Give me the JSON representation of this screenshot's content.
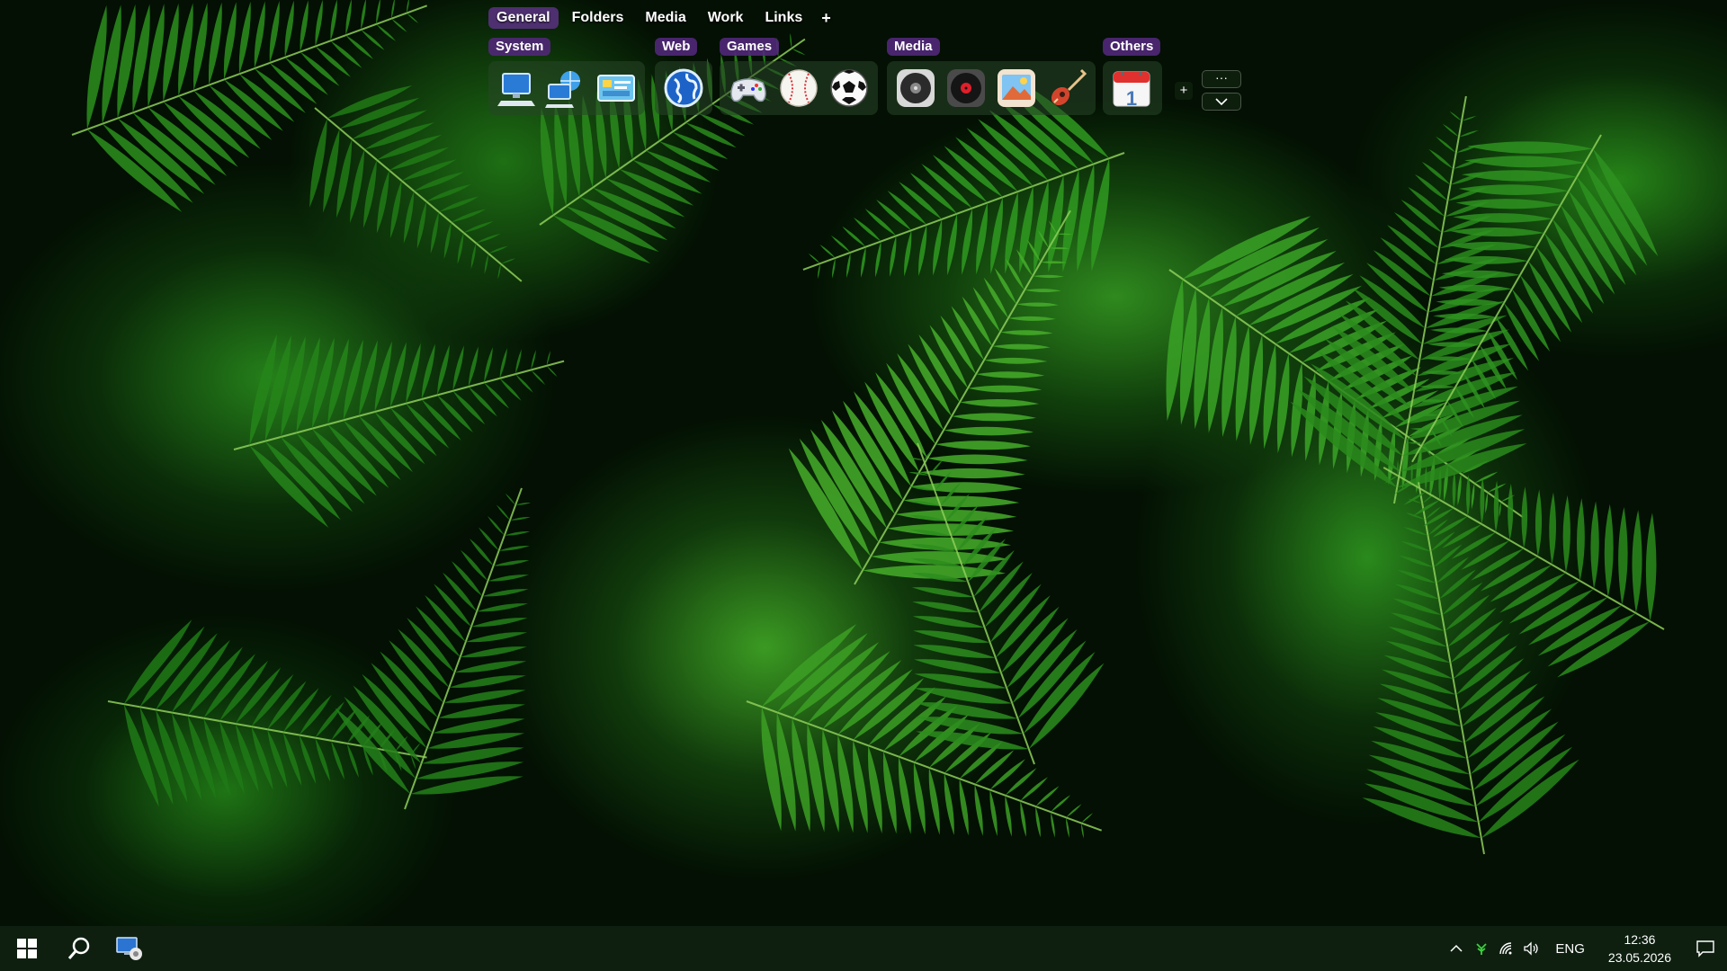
{
  "launcher": {
    "tabs": [
      {
        "label": "General",
        "active": true
      },
      {
        "label": "Folders",
        "active": false
      },
      {
        "label": "Media",
        "active": false
      },
      {
        "label": "Work",
        "active": false
      },
      {
        "label": "Links",
        "active": false
      }
    ],
    "add_tab_label": "+",
    "groups": [
      {
        "label": "System",
        "icons": [
          "desktop-computer-icon",
          "network-computer-icon",
          "control-panel-icon"
        ]
      },
      {
        "label": "Web",
        "icons": [
          "globe-browser-icon"
        ]
      },
      {
        "label": "Games",
        "icons": [
          "gamepad-icon",
          "baseball-icon",
          "soccer-ball-icon"
        ]
      },
      {
        "label": "Media",
        "icons": [
          "audio-disc-icon",
          "music-record-icon",
          "photos-icon",
          "guitar-icon"
        ]
      },
      {
        "label": "Others",
        "icons": [
          "calendar-icon"
        ]
      }
    ],
    "calendar_day": "1",
    "add_group_label": "+",
    "more_label": "···"
  },
  "taskbar": {
    "language": "ENG",
    "time": "12:36",
    "date": "23.05.2026"
  }
}
